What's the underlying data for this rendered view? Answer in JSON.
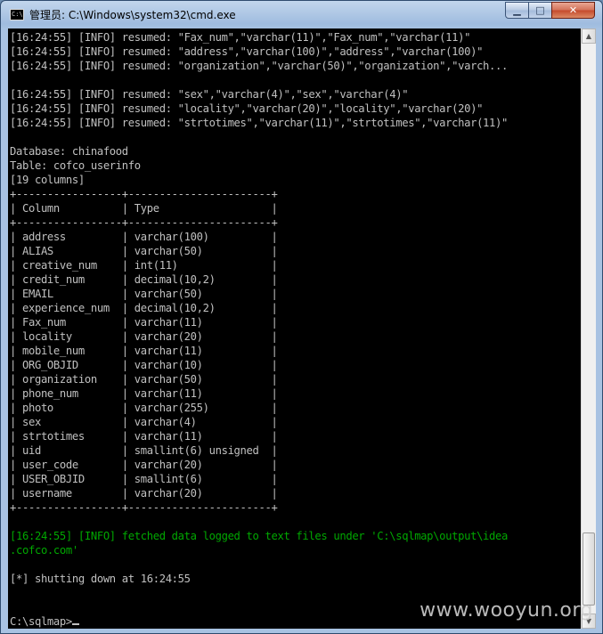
{
  "window": {
    "title": "管理员: C:\\Windows\\system32\\cmd.exe",
    "icon_text": "C:\\",
    "controls": {
      "minimize": "▁",
      "maximize": "□",
      "close": "✕"
    }
  },
  "console": {
    "lines": [
      "[16:24:55] [INFO] resumed: \"Fax_num\",\"varchar(11)\",\"Fax_num\",\"varchar(11)\"",
      "[16:24:55] [INFO] resumed: \"address\",\"varchar(100)\",\"address\",\"varchar(100)\"",
      "[16:24:55] [INFO] resumed: \"organization\",\"varchar(50)\",\"organization\",\"varch...",
      "",
      "[16:24:55] [INFO] resumed: \"sex\",\"varchar(4)\",\"sex\",\"varchar(4)\"",
      "[16:24:55] [INFO] resumed: \"locality\",\"varchar(20)\",\"locality\",\"varchar(20)\"",
      "[16:24:55] [INFO] resumed: \"strtotimes\",\"varchar(11)\",\"strtotimes\",\"varchar(11)\"",
      "",
      "Database: chinafood",
      "Table: cofco_userinfo",
      "[19 columns]",
      "+-----------------+-----------------------+",
      "| Column          | Type                  |",
      "+-----------------+-----------------------+",
      "| address         | varchar(100)          |",
      "| ALIAS           | varchar(50)           |",
      "| creative_num    | int(11)               |",
      "| credit_num      | decimal(10,2)         |",
      "| EMAIL           | varchar(50)           |",
      "| experience_num  | decimal(10,2)         |",
      "| Fax_num         | varchar(11)           |",
      "| locality        | varchar(20)           |",
      "| mobile_num      | varchar(11)           |",
      "| ORG_OBJID       | varchar(10)           |",
      "| organization    | varchar(50)           |",
      "| phone_num       | varchar(11)           |",
      "| photo           | varchar(255)          |",
      "| sex             | varchar(4)            |",
      "| strtotimes      | varchar(11)           |",
      "| uid             | smallint(6) unsigned  |",
      "| user_code       | varchar(20)           |",
      "| USER_OBJID      | smallint(6)           |",
      "| username        | varchar(20)           |",
      "+-----------------+-----------------------+",
      "",
      "[16:24:55] [INFO] fetched data logged to text files under 'C:\\sqlmap\\output\\idea",
      ".cofco.com'",
      "",
      "[*] shutting down at 16:24:55",
      "",
      "",
      "C:\\sqlmap>"
    ],
    "green_lines": [
      35,
      36
    ],
    "text_color": "#c0c0c0",
    "info_color": "#00a800",
    "background": "#000000"
  },
  "watermark": "www.wooyun.org"
}
